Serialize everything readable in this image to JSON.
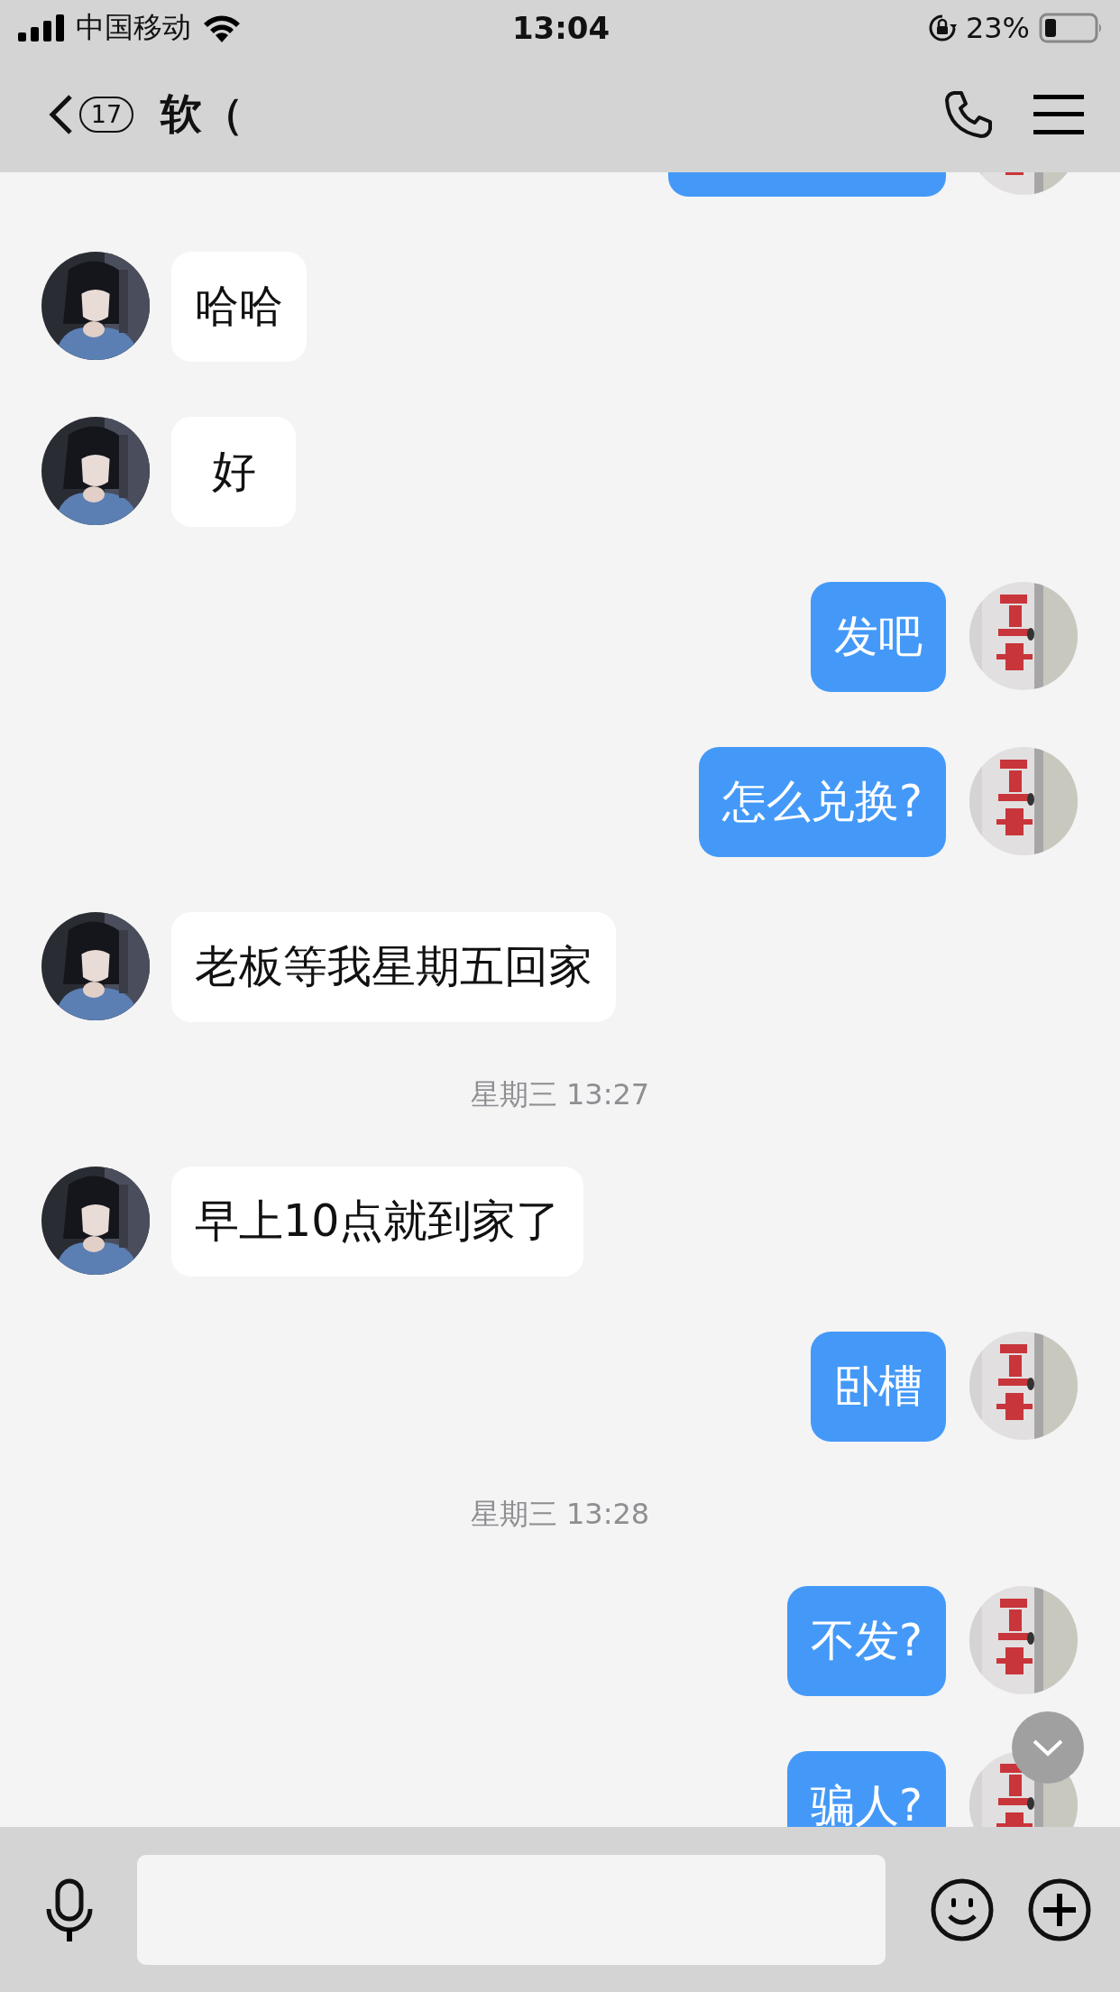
{
  "status_bar": {
    "carrier": "中国移动",
    "time": "13:04",
    "battery": "23%"
  },
  "nav_bar": {
    "unread_count": "17",
    "title": "软（"
  },
  "messages": [
    {
      "kind": "message",
      "outgoing": true
    },
    {
      "kind": "message",
      "outgoing": false,
      "text": "哈哈"
    },
    {
      "kind": "message",
      "outgoing": false,
      "text": "好"
    },
    {
      "kind": "message",
      "outgoing": true,
      "text": "发吧"
    },
    {
      "kind": "message",
      "outgoing": true,
      "text": "怎么兑换?"
    },
    {
      "kind": "message",
      "outgoing": false,
      "text": "老板等我星期五回家"
    },
    {
      "kind": "time",
      "text": "星期三 13:27"
    },
    {
      "kind": "message",
      "outgoing": false,
      "text": "早上10点就到家了"
    },
    {
      "kind": "message",
      "outgoing": true,
      "text": "卧槽"
    },
    {
      "kind": "time",
      "text": "星期三 13:28"
    },
    {
      "kind": "message",
      "outgoing": true,
      "text": "不发?"
    },
    {
      "kind": "message",
      "outgoing": true,
      "text": "骗人?"
    }
  ]
}
